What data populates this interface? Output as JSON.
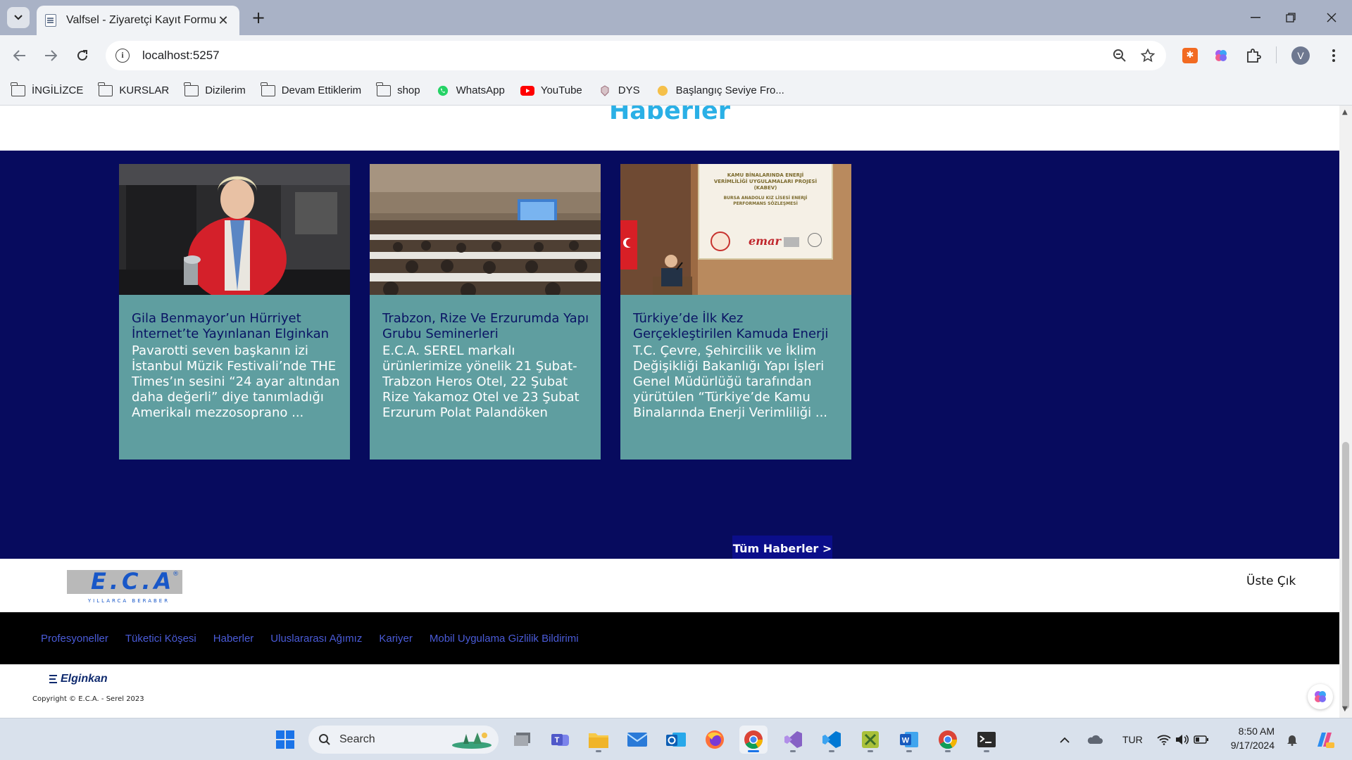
{
  "browser": {
    "tab_title": "Valfsel - Ziyaretçi Kayıt Formu",
    "url": "localhost:5257",
    "profile_initial": "V",
    "bookmarks": [
      {
        "label": "İNGİLİZCE",
        "icon": "folder-icon"
      },
      {
        "label": "KURSLAR",
        "icon": "folder-icon"
      },
      {
        "label": "Dizilerim",
        "icon": "folder-icon"
      },
      {
        "label": "Devam Ettiklerim",
        "icon": "folder-icon"
      },
      {
        "label": "shop",
        "icon": "folder-icon"
      },
      {
        "label": "WhatsApp",
        "icon": "whatsapp-icon"
      },
      {
        "label": "YouTube",
        "icon": "youtube-icon"
      },
      {
        "label": "DYS",
        "icon": "dys-icon"
      },
      {
        "label": "Başlangıç Seviye Fro...",
        "icon": "bookmark-site-icon"
      }
    ]
  },
  "page": {
    "news_heading": "Haberler",
    "cards": [
      {
        "title": "Gila Benmayor’un Hürriyet İnternet’te Yayınlanan Elginkan",
        "text": "Pavarotti seven başkanın izi İstanbul Müzik Festivali’nde THE Times’ın sesini “24 ayar altından daha değerli” diye tanımladığı Amerikalı mezzosoprano ..."
      },
      {
        "title": "Trabzon, Rize Ve Erzurumda Yapı Grubu Seminerleri",
        "text": "E.C.A. SEREL markalı ürünlerimize yönelik 21 Şubat- Trabzon Heros Otel, 22 Şubat Rize Yakamoz Otel ve 23 Şubat Erzurum Polat Palandöken Otel’de yapı g ..."
      },
      {
        "title": "Türkiye’de İlk Kez Gerçekleştirilen Kamuda Enerji",
        "text": "T.C. Çevre, Şehircilik ve İklim Değişikliği Bakanlığı Yapı İşleri Genel Müdürlüğü tarafından yürütülen “Türkiye’de Kamu Binalarında Enerji Verimliliği ..."
      }
    ],
    "all_news_button": "Tüm Haberler >",
    "logo_text": "E.C.A",
    "logo_tagline": "YILLARCA BERABER",
    "back_to_top": "Üste Çık",
    "footer_links": [
      "Profesyoneller",
      "Tüketici Köşesi",
      "Haberler",
      "Uluslararası Ağımız",
      "Kariyer",
      "Mobil Uygulama Gizlilik Bildirimi"
    ],
    "brand_name": "Elginkan",
    "copyright": "Copyright © E.C.A. - Serel 2023",
    "slide_sign": {
      "line1": "KAMU BİNALARINDA ENERJİ",
      "line2": "VERİMLİLİĞİ UYGULAMALARI PROJESİ",
      "line3": "(KABEV)",
      "line4": "BURSA ANADOLU KIZ LİSESİ ENERJİ",
      "line5": "PERFORMANS SÖZLEŞMESİ",
      "logo": "emar"
    }
  },
  "taskbar": {
    "search_label": "Search",
    "language": "TUR",
    "time": "8:50 AM",
    "date": "9/17/2024"
  },
  "colors": {
    "news_section_bg": "#070b5e",
    "card_bg": "#5f9ea0",
    "heading": "#2ab0e6",
    "footer_link": "#4a5bd8"
  }
}
